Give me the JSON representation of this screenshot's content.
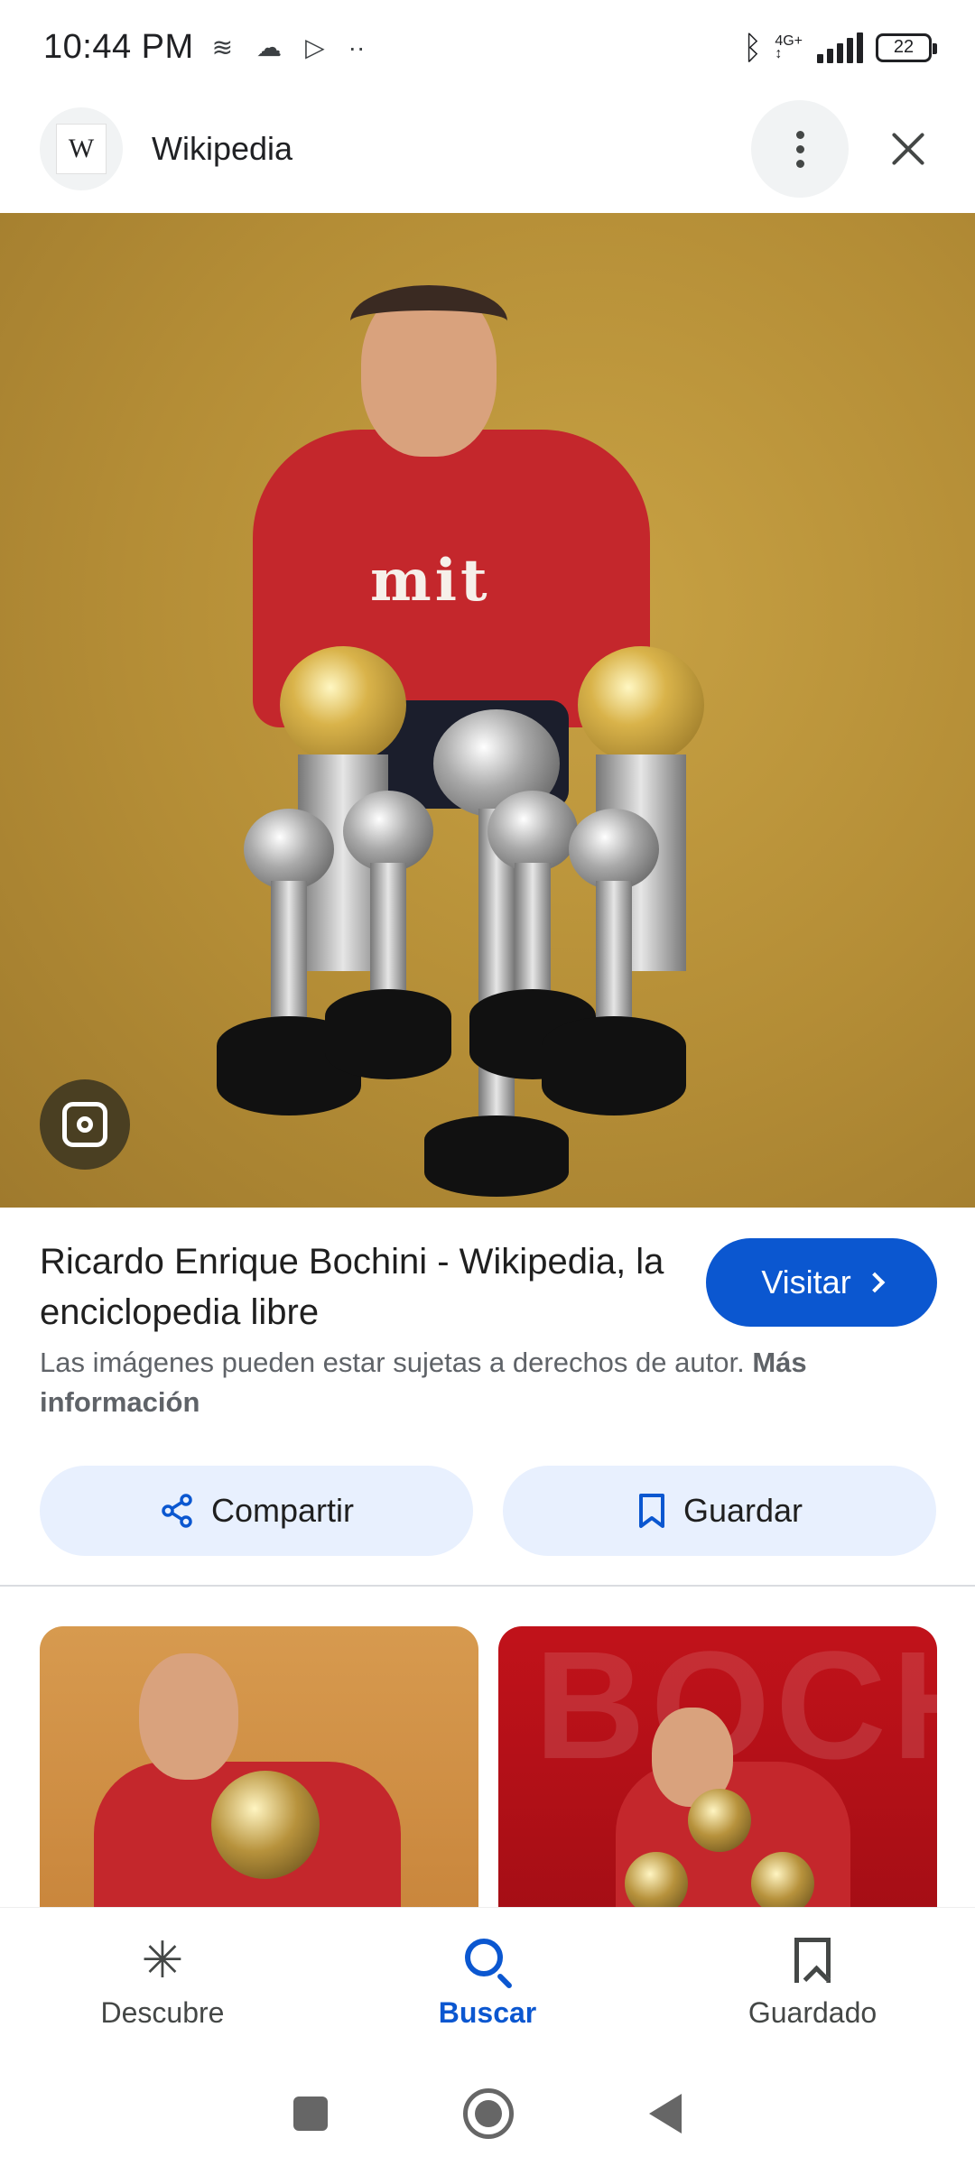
{
  "status_bar": {
    "time": "10:44 PM",
    "network_type": "4G+",
    "battery": "22",
    "icons": [
      "layers-icon",
      "cloud-icon",
      "play-icon",
      "more-dots-icon",
      "bluetooth-icon",
      "signal-icon",
      "battery-icon"
    ]
  },
  "header": {
    "site_logo_letter": "W",
    "site_name": "Wikipedia"
  },
  "result": {
    "title": "Ricardo Enrique Bochini - Wikipedia, la enciclopedia libre",
    "visit_label": "Visitar",
    "copyright_text": "Las imágenes pueden estar sujetas a derechos de autor.",
    "more_info_label": "Más información"
  },
  "actions": {
    "share_label": "Compartir",
    "save_label": "Guardar"
  },
  "image": {
    "shirt_text": "mit"
  },
  "related": {
    "thumb2_word": "BOCHINI"
  },
  "bottom_nav": {
    "items": [
      {
        "label": "Descubre",
        "icon": "asterisk-icon"
      },
      {
        "label": "Buscar",
        "icon": "search-icon"
      },
      {
        "label": "Guardado",
        "icon": "bookmarks-icon"
      }
    ],
    "active": "Buscar"
  },
  "colors": {
    "accent": "#0b57d0",
    "button_bg": "#e8f0fe",
    "hero_bg": "#b48d36"
  }
}
